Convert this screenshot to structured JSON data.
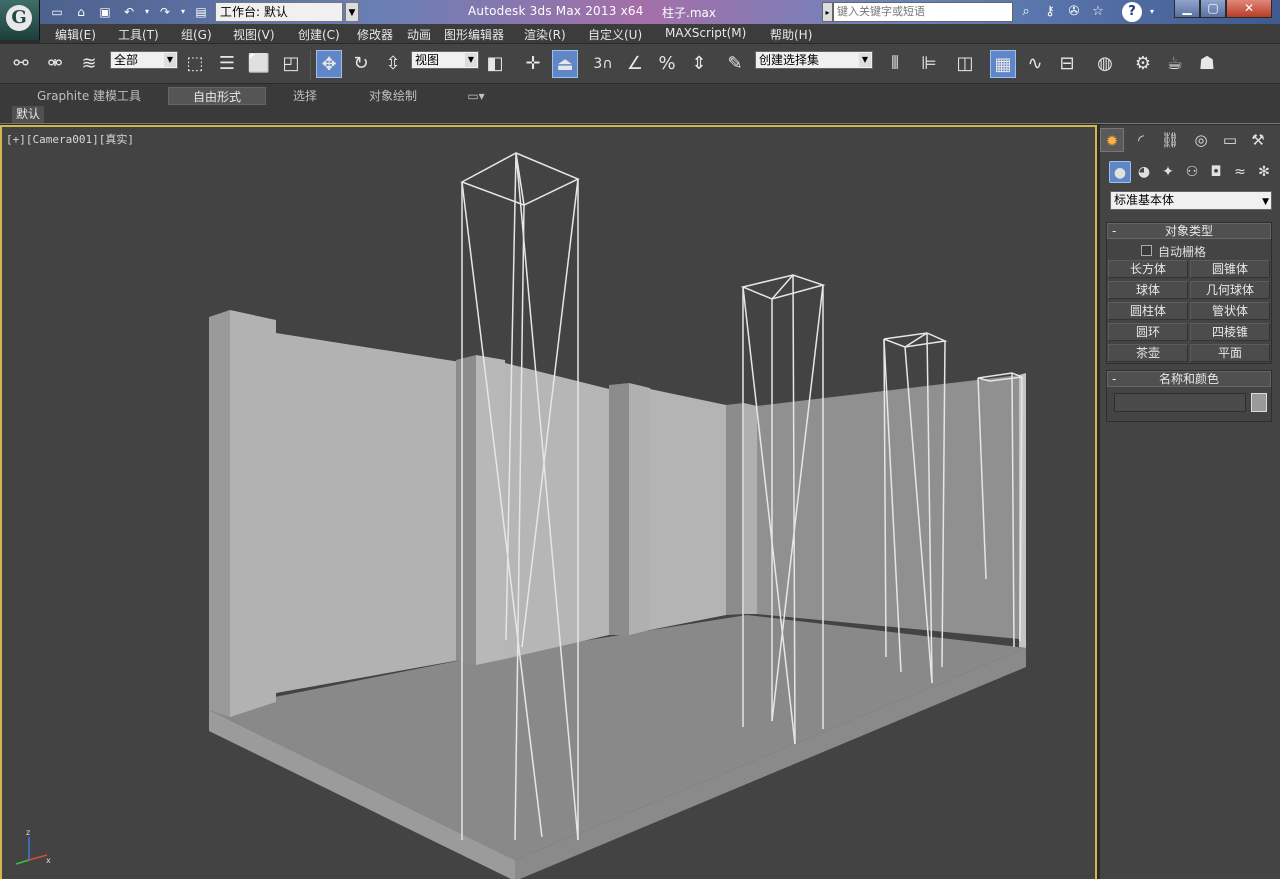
{
  "titlebar": {
    "workspace_label": "工作台: 默认",
    "app_title": "Autodesk 3ds Max  2013 x64",
    "file_title": "柱子.max",
    "search_placeholder": "键入关键字或短语",
    "help_label": "?"
  },
  "menu": [
    "编辑(E)",
    "工具(T)",
    "组(G)",
    "视图(V)",
    "创建(C)",
    "修改器",
    "动画",
    "图形编辑器",
    "渲染(R)",
    "自定义(U)",
    "MAXScript(M)",
    "帮助(H)"
  ],
  "toolbar": {
    "selection_filter": "全部",
    "ref_coord": "视图",
    "named_selection": "创建选择集",
    "snap_3d_label": "3"
  },
  "ribbon": {
    "tabs": [
      "Graphite 建模工具",
      "自由形式",
      "选择",
      "对象绘制"
    ],
    "active_tab": 1,
    "sub_label": "默认"
  },
  "viewport": {
    "label": "[+][Camera001][真实]",
    "axis_z": "z",
    "axis_x": "x"
  },
  "command_panel": {
    "type_dropdown": "标准基本体",
    "object_type_title": "对象类型",
    "autogrid_label": "自动栅格",
    "primitives": [
      "长方体",
      "圆锥体",
      "球体",
      "几何球体",
      "圆柱体",
      "管状体",
      "圆环",
      "四棱锥",
      "茶壶",
      "平面"
    ],
    "name_color_title": "名称和颜色",
    "object_color": "#9a9a9a"
  },
  "colors": {
    "viewport_border": "#d2b84c",
    "active_tool": "#5f86c6"
  }
}
